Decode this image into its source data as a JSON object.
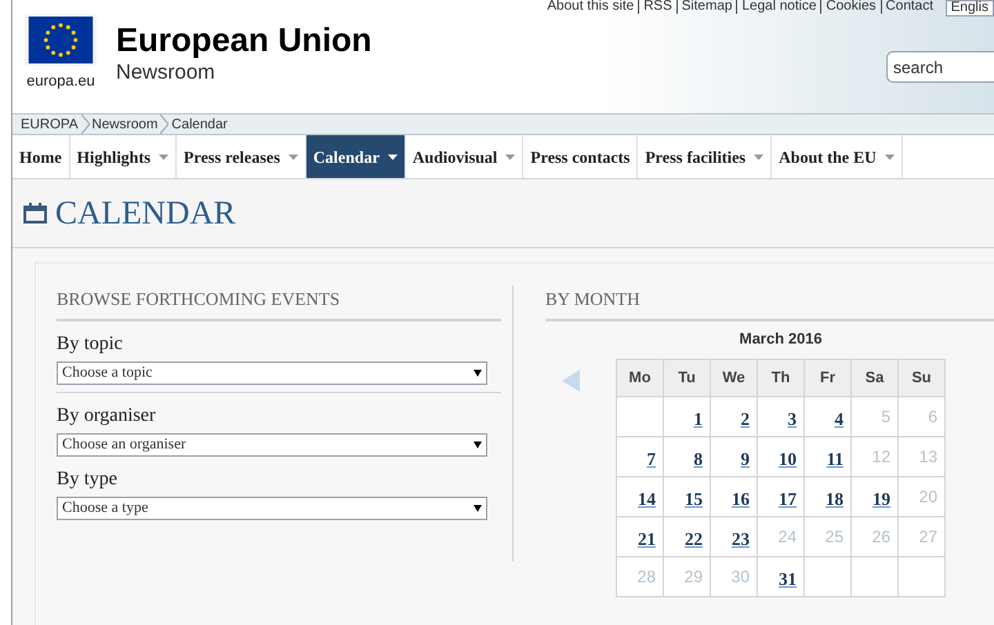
{
  "top_links": [
    "About this site",
    "RSS",
    "Sitemap",
    "Legal notice",
    "Cookies",
    "Contact"
  ],
  "language": "Englis",
  "logo": {
    "caption": "europa.eu"
  },
  "site": {
    "title": "European Union",
    "subtitle": "Newsroom"
  },
  "search": {
    "placeholder": "search"
  },
  "breadcrumb": [
    "EUROPA",
    "Newsroom",
    "Calendar"
  ],
  "nav": [
    {
      "label": "Home",
      "dropdown": false,
      "selected": false
    },
    {
      "label": "Highlights",
      "dropdown": true,
      "selected": false
    },
    {
      "label": "Press releases",
      "dropdown": true,
      "selected": false
    },
    {
      "label": "Calendar",
      "dropdown": true,
      "selected": true
    },
    {
      "label": "Audiovisual",
      "dropdown": true,
      "selected": false
    },
    {
      "label": "Press contacts",
      "dropdown": false,
      "selected": false
    },
    {
      "label": "Press facilities",
      "dropdown": true,
      "selected": false
    },
    {
      "label": "About the EU",
      "dropdown": true,
      "selected": false
    }
  ],
  "page_title": "CALENDAR",
  "browse": {
    "heading": "BROWSE FORTHCOMING EVENTS",
    "filters": [
      {
        "label": "By topic",
        "placeholder": "Choose a topic"
      },
      {
        "label": "By organiser",
        "placeholder": "Choose an organiser"
      },
      {
        "label": "By type",
        "placeholder": "Choose a type"
      }
    ]
  },
  "by_month": {
    "heading": "BY MONTH",
    "month": "March 2016",
    "weekdays": [
      "Mo",
      "Tu",
      "We",
      "Th",
      "Fr",
      "Sa",
      "Su"
    ],
    "weeks": [
      [
        {
          "kind": "empty"
        },
        {
          "kind": "link",
          "day": "1"
        },
        {
          "kind": "link",
          "day": "2"
        },
        {
          "kind": "link",
          "day": "3"
        },
        {
          "kind": "link",
          "day": "4"
        },
        {
          "kind": "plain",
          "day": "5"
        },
        {
          "kind": "plain",
          "day": "6"
        }
      ],
      [
        {
          "kind": "link",
          "day": "7"
        },
        {
          "kind": "link",
          "day": "8"
        },
        {
          "kind": "link",
          "day": "9"
        },
        {
          "kind": "link",
          "day": "10"
        },
        {
          "kind": "link",
          "day": "11"
        },
        {
          "kind": "plain",
          "day": "12"
        },
        {
          "kind": "plain",
          "day": "13"
        }
      ],
      [
        {
          "kind": "link",
          "day": "14"
        },
        {
          "kind": "link",
          "day": "15"
        },
        {
          "kind": "link",
          "day": "16"
        },
        {
          "kind": "link",
          "day": "17"
        },
        {
          "kind": "link",
          "day": "18"
        },
        {
          "kind": "link",
          "day": "19"
        },
        {
          "kind": "plain",
          "day": "20"
        }
      ],
      [
        {
          "kind": "link",
          "day": "21"
        },
        {
          "kind": "link",
          "day": "22"
        },
        {
          "kind": "link",
          "day": "23"
        },
        {
          "kind": "plain",
          "day": "24"
        },
        {
          "kind": "plain",
          "day": "25"
        },
        {
          "kind": "plain",
          "day": "26"
        },
        {
          "kind": "plain",
          "day": "27"
        }
      ],
      [
        {
          "kind": "plain",
          "day": "28"
        },
        {
          "kind": "plain",
          "day": "29"
        },
        {
          "kind": "plain",
          "day": "30"
        },
        {
          "kind": "link",
          "day": "31"
        },
        {
          "kind": "empty"
        },
        {
          "kind": "empty"
        },
        {
          "kind": "empty"
        }
      ]
    ]
  }
}
